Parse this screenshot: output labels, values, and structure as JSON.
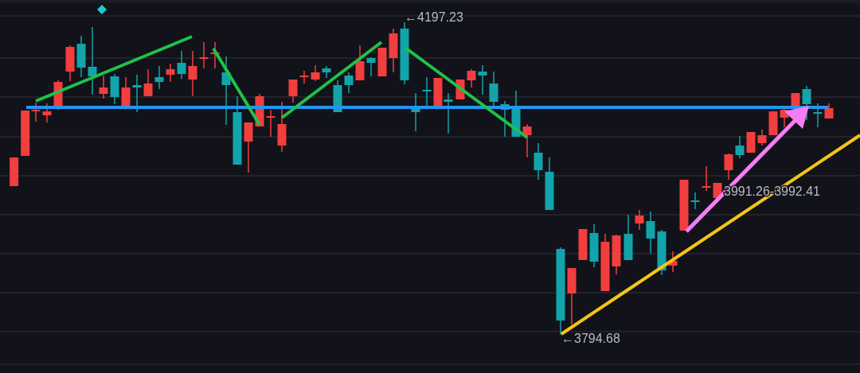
{
  "chart": {
    "price_labels": [
      {
        "text": "←4197.23"
      },
      {
        "text": "3991.26-3992.41"
      },
      {
        "text": "←3794.68"
      }
    ]
  }
}
